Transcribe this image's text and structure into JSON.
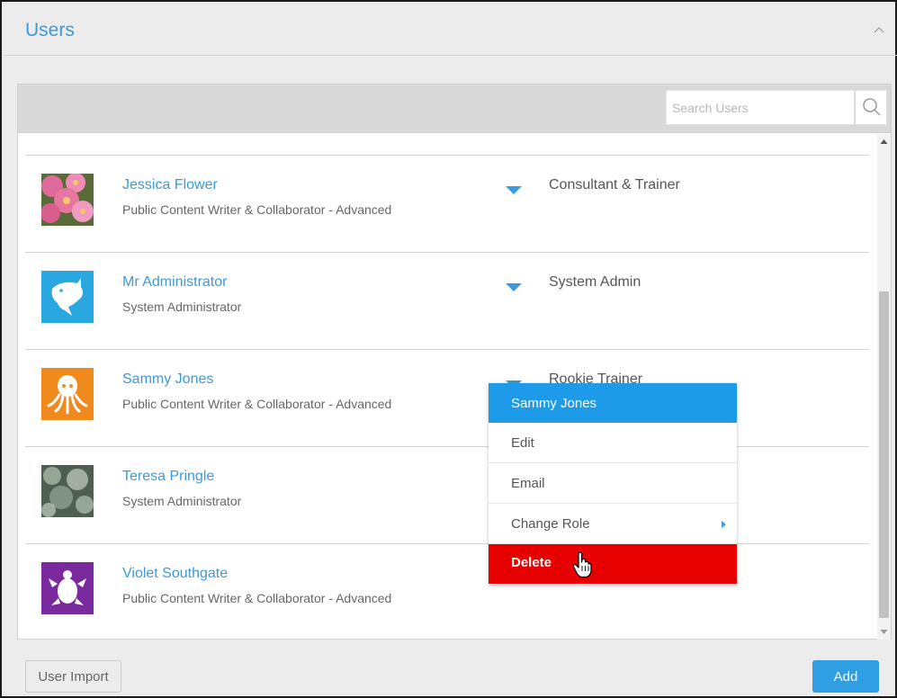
{
  "panel": {
    "title": "Users"
  },
  "search": {
    "placeholder": "Search Users",
    "value": ""
  },
  "users": [
    {
      "name": "Jessica Flower",
      "role": "Public Content Writer & Collaborator - Advanced",
      "title": "Consultant & Trainer",
      "avatar_icon": "flower-photo-avatar"
    },
    {
      "name": "Mr Administrator",
      "role": "System Administrator",
      "title": "System Admin",
      "avatar_icon": "shark-icon"
    },
    {
      "name": "Sammy Jones",
      "role": "Public Content Writer & Collaborator - Advanced",
      "title": "Rookie Trainer",
      "avatar_icon": "octopus-icon"
    },
    {
      "name": "Teresa Pringle",
      "role": "System Administrator",
      "title": "",
      "avatar_icon": "bokeh-photo-avatar"
    },
    {
      "name": "Violet Southgate",
      "role": "Public Content Writer & Collaborator - Advanced",
      "title": "",
      "avatar_icon": "turtle-icon"
    }
  ],
  "context_menu": {
    "header": "Sammy Jones",
    "items": [
      "Edit",
      "Email",
      "Change Role"
    ],
    "delete_label": "Delete"
  },
  "footer": {
    "import_label": "User Import",
    "add_label": "Add"
  },
  "colors": {
    "accent": "#3b9ad9",
    "menu_header": "#1e9be8",
    "delete": "#e60000",
    "avatar_blue": "#29a8e0",
    "avatar_orange": "#f08a1c",
    "avatar_purple": "#7a2a9c"
  }
}
